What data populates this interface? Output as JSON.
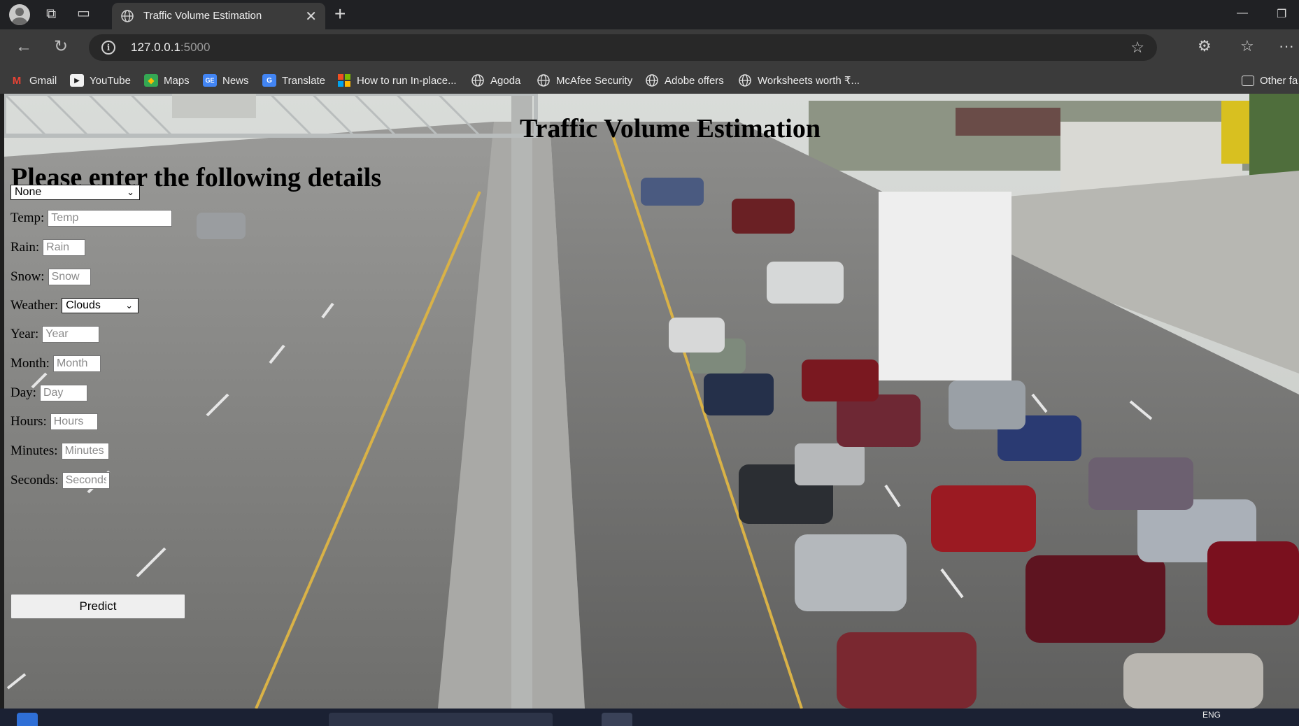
{
  "browser": {
    "tab_title": "Traffic Volume Estimation",
    "url_host": "127.0.0.1",
    "url_port": ":5000",
    "bookmarks": [
      {
        "label": "Gmail",
        "icon": "gmail-icon"
      },
      {
        "label": "YouTube",
        "icon": "youtube-icon"
      },
      {
        "label": "Maps",
        "icon": "maps-icon"
      },
      {
        "label": "News",
        "icon": "news-icon"
      },
      {
        "label": "Translate",
        "icon": "translate-icon"
      },
      {
        "label": "How to run In-place...",
        "icon": "windows-icon"
      },
      {
        "label": "Agoda",
        "icon": "globe-icon"
      },
      {
        "label": "McAfee Security",
        "icon": "globe-icon"
      },
      {
        "label": "Adobe offers",
        "icon": "globe-icon"
      },
      {
        "label": "Worksheets worth ₹...",
        "icon": "globe-icon"
      }
    ],
    "other_favorites": "Other fa"
  },
  "page": {
    "title": "Traffic Volume Estimation",
    "form_heading": "Please enter the following details",
    "holiday_select": "None",
    "fields": {
      "temp": {
        "label": "Temp:",
        "placeholder": "Temp"
      },
      "rain": {
        "label": "Rain:",
        "placeholder": "Rain"
      },
      "snow": {
        "label": "Snow:",
        "placeholder": "Snow"
      },
      "weather": {
        "label": "Weather:",
        "value": "Clouds"
      },
      "year": {
        "label": "Year:",
        "placeholder": "Year"
      },
      "month": {
        "label": "Month:",
        "placeholder": "Month"
      },
      "day": {
        "label": "Day:",
        "placeholder": "Day"
      },
      "hours": {
        "label": "Hours:",
        "placeholder": "Hours"
      },
      "minutes": {
        "label": "Minutes:",
        "placeholder": "Minutes"
      },
      "seconds": {
        "label": "Seconds:",
        "placeholder": "Seconds"
      }
    },
    "predict_label": "Predict"
  },
  "taskbar": {
    "lang": "ENG"
  }
}
